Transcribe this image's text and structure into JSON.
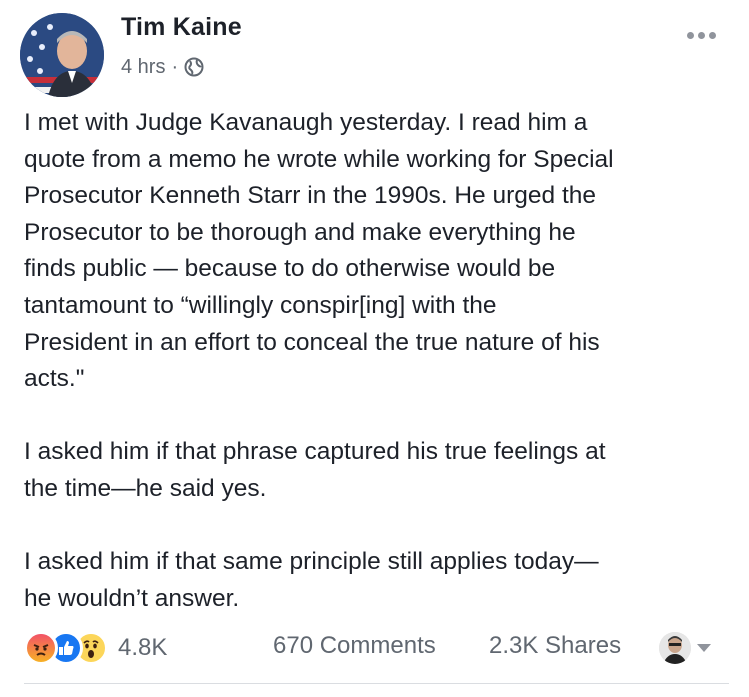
{
  "post": {
    "author": "Tim Kaine",
    "time": "4 hrs",
    "separator": "·",
    "privacy_icon": "globe-icon",
    "text_lines": [
      "I met with Judge Kavanaugh yesterday. I read him a",
      "quote from a memo he wrote while working for Special",
      "Prosecutor Kenneth Starr in the 1990s. He urged the",
      "Prosecutor to be thorough and make everything he",
      "finds public — because to do otherwise would be",
      "tantamount to “willingly conspir[ing] with the",
      "President in an effort to conceal the true nature of his",
      "acts.\"",
      "I asked him if that phrase captured his true feelings at",
      "the time—he said yes.",
      "I asked him if that same principle still applies today—",
      "he wouldn’t answer."
    ]
  },
  "footer": {
    "reaction_icons": [
      "angry-icon",
      "like-icon",
      "wow-icon"
    ],
    "reaction_count": "4.8K",
    "comments": "670 Comments",
    "shares": "2.3K Shares"
  },
  "colors": {
    "text": "#1d2129",
    "meta": "#606770",
    "like_blue": "#1877f2",
    "angry_top": "#f25268",
    "wow_yellow": "#fcd65a"
  }
}
